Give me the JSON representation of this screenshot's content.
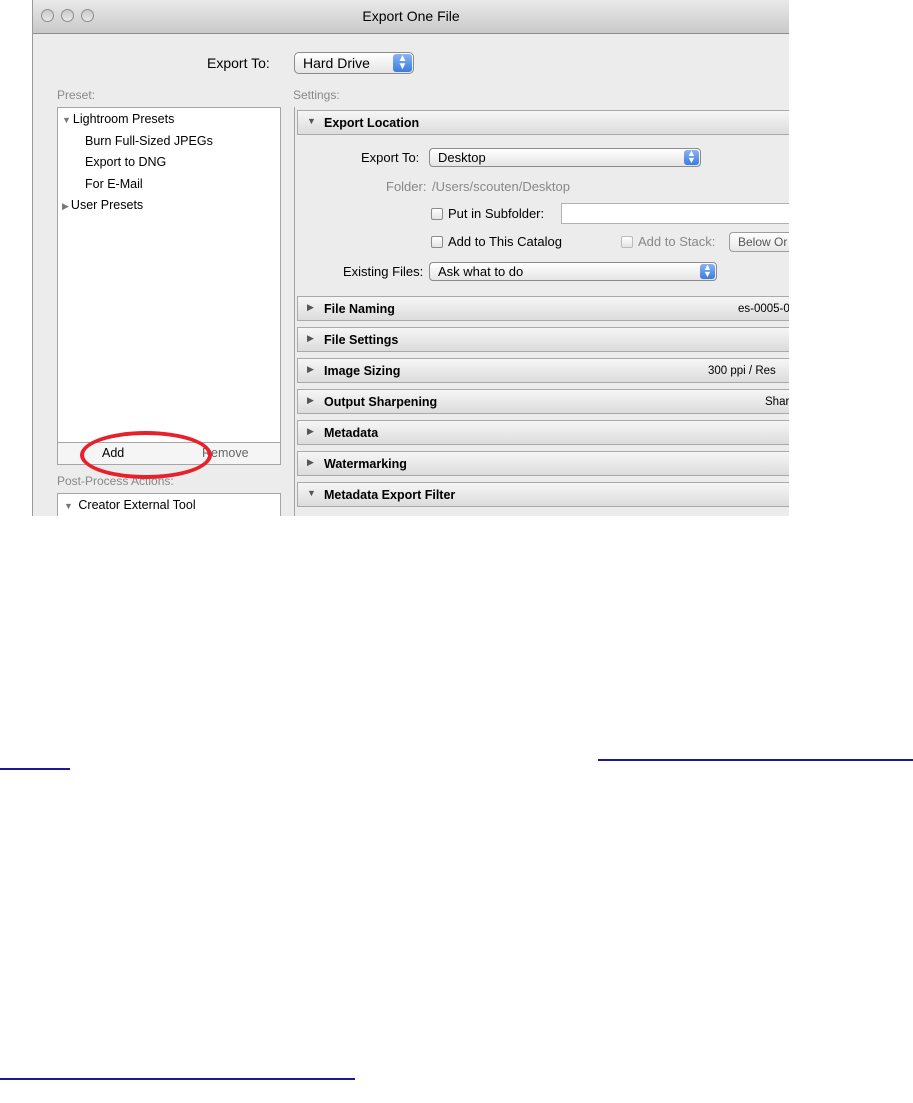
{
  "window": {
    "title": "Export One File",
    "export_to_label": "Export To:",
    "export_to_value": "Hard Drive"
  },
  "preset": {
    "header": "Preset:",
    "tree": [
      {
        "label": "Lightroom Presets",
        "expanded": true
      },
      {
        "label": "Burn Full-Sized JPEGs"
      },
      {
        "label": "Export to DNG"
      },
      {
        "label": "For E-Mail"
      },
      {
        "label": "User Presets",
        "expanded": false
      }
    ],
    "add_label": "Add",
    "remove_label": "Remove"
  },
  "post_process": {
    "header": "Post-Process Actions:",
    "item": "Creator External Tool"
  },
  "settings": {
    "header": "Settings:",
    "export_location": {
      "title": "Export Location",
      "export_to_label": "Export To:",
      "export_to_value": "Desktop",
      "folder_label": "Folder:",
      "folder_value": "/Users/scouten/Desktop",
      "subfolder_label": "Put in Subfolder:",
      "add_catalog_label": "Add to This Catalog",
      "add_stack_label": "Add to Stack:",
      "stack_value": "Below Or",
      "existing_files_label": "Existing Files:",
      "existing_files_value": "Ask what to do"
    },
    "sections": [
      {
        "title": "File Naming",
        "summary": "es-0005-0"
      },
      {
        "title": "File Settings",
        "summary": ""
      },
      {
        "title": "Image Sizing",
        "summary": "300 ppi / Res"
      },
      {
        "title": "Output Sharpening",
        "summary": "Sharp"
      },
      {
        "title": "Metadata",
        "summary": ""
      },
      {
        "title": "Watermarking",
        "summary": ""
      },
      {
        "title": "Metadata Export Filter",
        "summary": ""
      }
    ]
  },
  "annotation": {
    "color": "#e8202a"
  }
}
